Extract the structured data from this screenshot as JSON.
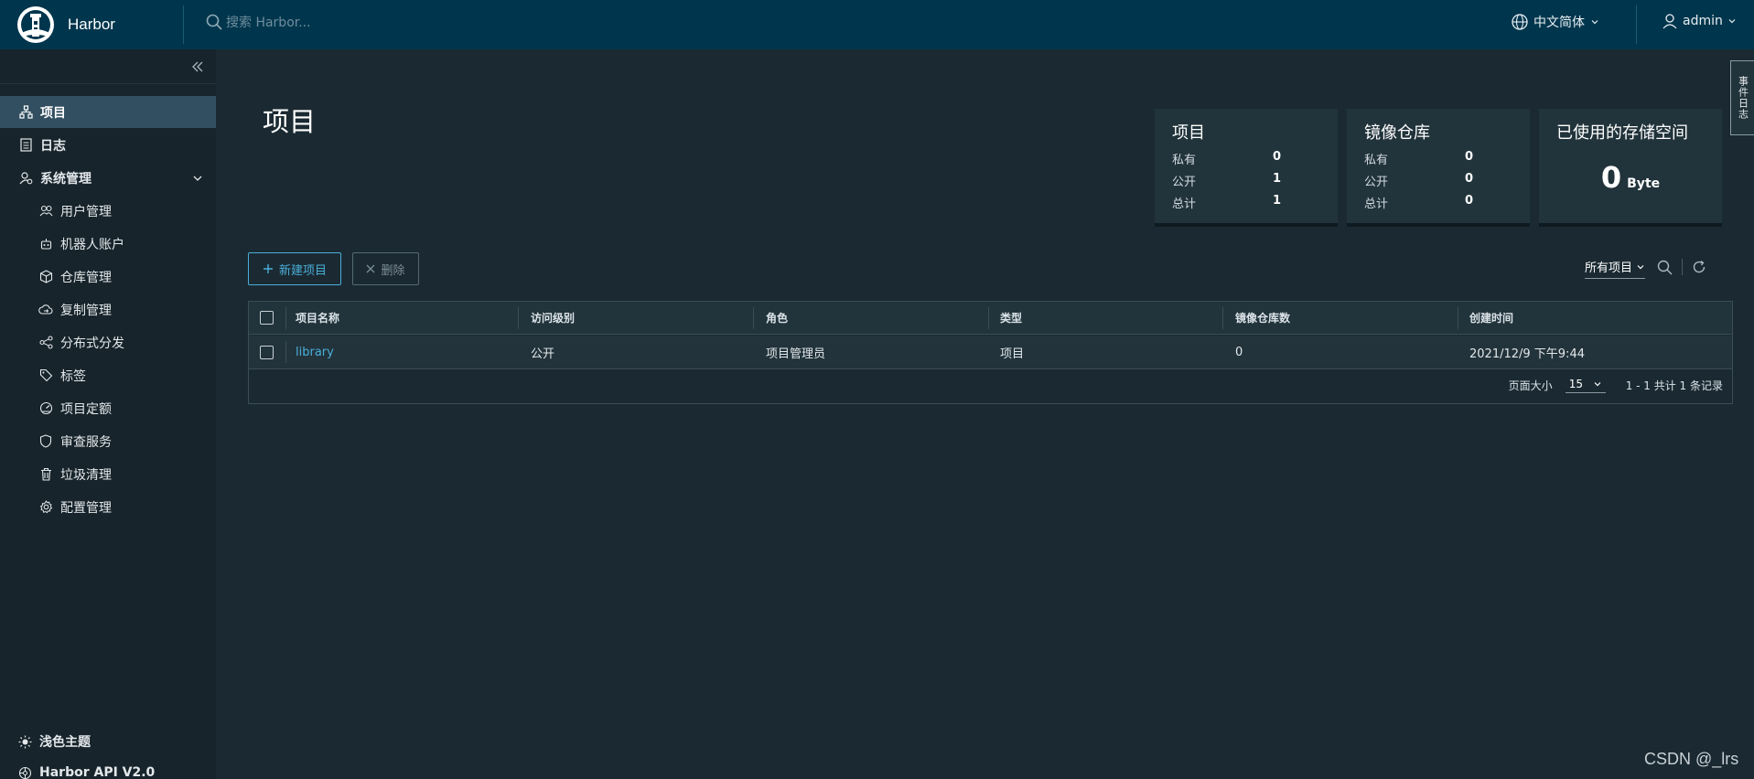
{
  "header": {
    "title": "Harbor",
    "search_placeholder": "搜索 Harbor...",
    "language": "中文简体",
    "user": "admin"
  },
  "sidebar": {
    "items": [
      {
        "label": "项目",
        "icon": "projects-icon"
      },
      {
        "label": "日志",
        "icon": "logs-icon"
      },
      {
        "label": "系统管理",
        "icon": "admin-icon"
      },
      {
        "label": "用户管理",
        "icon": "users-icon"
      },
      {
        "label": "机器人账户",
        "icon": "robot-icon"
      },
      {
        "label": "仓库管理",
        "icon": "registry-icon"
      },
      {
        "label": "复制管理",
        "icon": "replication-icon"
      },
      {
        "label": "分布式分发",
        "icon": "distribution-icon"
      },
      {
        "label": "标签",
        "icon": "tag-icon"
      },
      {
        "label": "项目定额",
        "icon": "quota-icon"
      },
      {
        "label": "审查服务",
        "icon": "shield-icon"
      },
      {
        "label": "垃圾清理",
        "icon": "trash-icon"
      },
      {
        "label": "配置管理",
        "icon": "gear-icon"
      }
    ],
    "theme_label": "浅色主题",
    "api_label": "Harbor API V2.0"
  },
  "main": {
    "title": "项目",
    "cards": {
      "projects": {
        "title": "项目",
        "rows": [
          {
            "label": "私有",
            "value": "0"
          },
          {
            "label": "公开",
            "value": "1"
          },
          {
            "label": "总计",
            "value": "1"
          }
        ]
      },
      "repos": {
        "title": "镜像仓库",
        "rows": [
          {
            "label": "私有",
            "value": "0"
          },
          {
            "label": "公开",
            "value": "0"
          },
          {
            "label": "总计",
            "value": "0"
          }
        ]
      },
      "storage": {
        "title": "已使用的存储空间",
        "value": "0",
        "unit": "Byte"
      }
    },
    "buttons": {
      "new_project": "新建项目",
      "delete": "删除"
    },
    "filter": "所有项目",
    "table": {
      "columns": [
        "项目名称",
        "访问级别",
        "角色",
        "类型",
        "镜像仓库数",
        "创建时间"
      ],
      "rows": [
        {
          "name": "library",
          "access": "公开",
          "role": "项目管理员",
          "type": "项目",
          "repo_count": "0",
          "created": "2021/12/9 下午9:44"
        }
      ]
    },
    "pager": {
      "page_size_label": "页面大小",
      "page_size": "15",
      "summary": "1 - 1 共计 1 条记录"
    }
  },
  "right_tab": "事件日志",
  "watermark": "CSDN @_lrs",
  "colors": {
    "header_bg": "#00364d",
    "sidebar_bg": "#17242b",
    "content_bg": "#1b2a32",
    "accent": "#4aaed9",
    "active_item": "#324f61"
  }
}
